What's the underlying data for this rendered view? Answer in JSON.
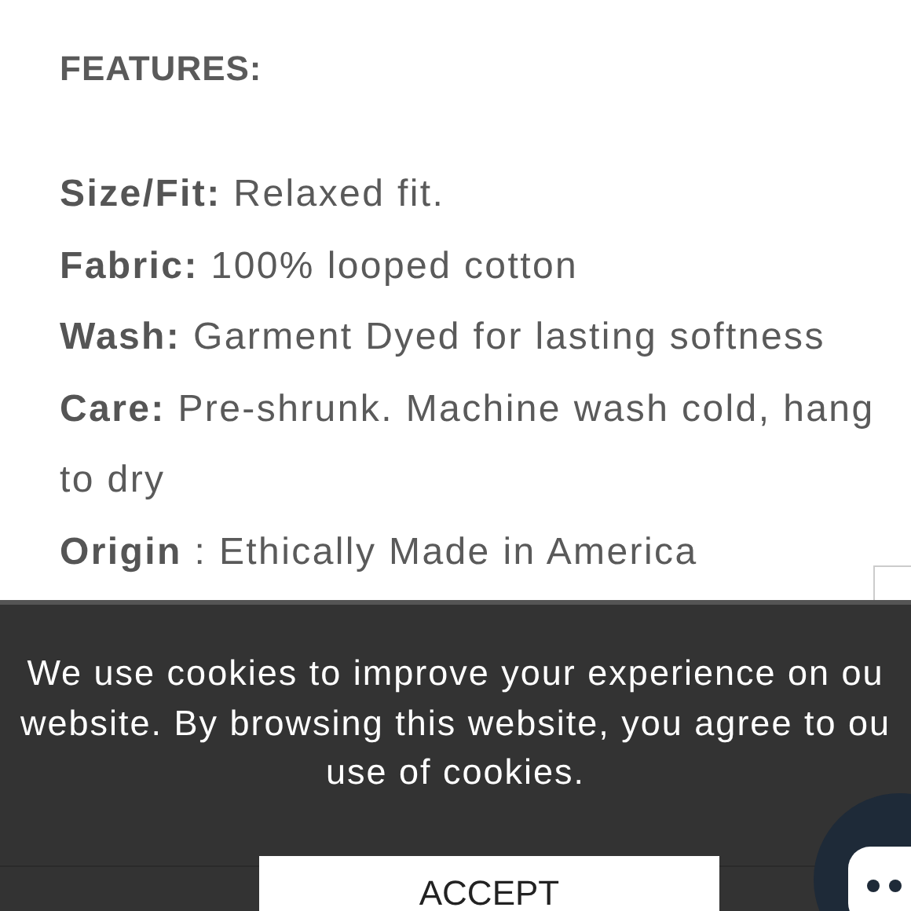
{
  "heading": "FEATURES:",
  "features": [
    {
      "label": "Size/Fit:",
      "value": "Relaxed fit."
    },
    {
      "label": "Fabric:",
      "value": "100% looped cotton"
    },
    {
      "label": "Wash:",
      "value": "Garment Dyed for lasting softness"
    },
    {
      "label": "Care:",
      "value": "Pre-shrunk. Machine wash cold, hang to dry"
    },
    {
      "label": "Origin",
      "value": ":  Ethically Made in America"
    }
  ],
  "cookie_banner": {
    "lines": [
      "We use cookies to improve your experience on ou",
      "website. By browsing this website, you agree to ou",
      "use of cookies."
    ],
    "button": "ACCEPT"
  }
}
